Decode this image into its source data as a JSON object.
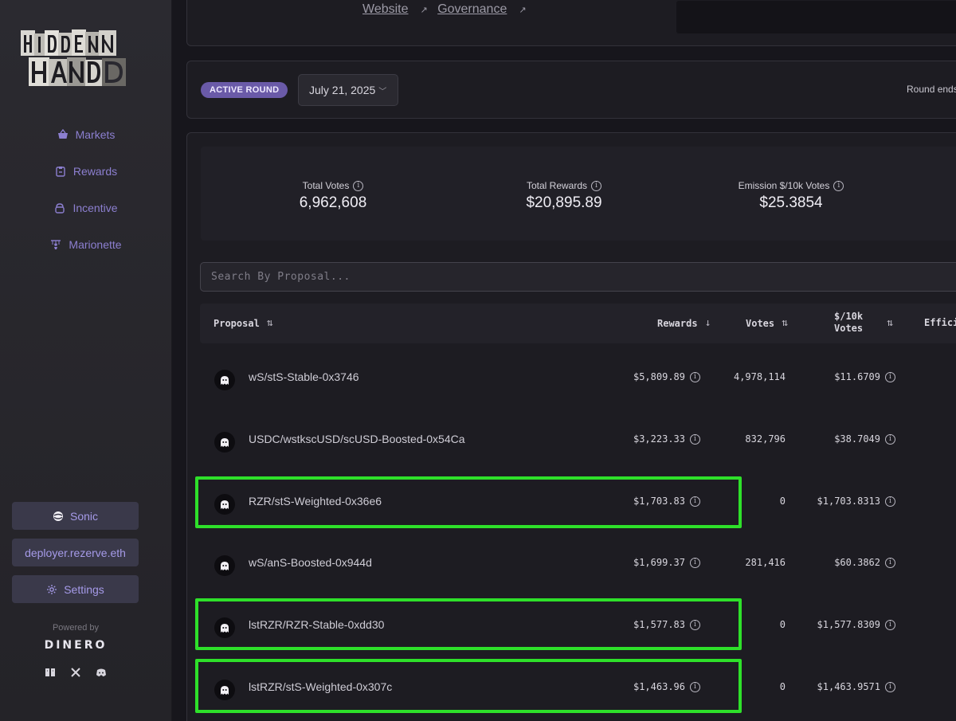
{
  "sidebar": {
    "nav": [
      {
        "label": "Markets",
        "icon": "basket-icon"
      },
      {
        "label": "Rewards",
        "icon": "clipboard-icon"
      },
      {
        "label": "Incentive",
        "icon": "bag-icon"
      },
      {
        "label": "Marionette",
        "icon": "puppet-icon"
      }
    ],
    "network_label": "Sonic",
    "account_label": "deployer.rezerve.eth",
    "settings_label": "Settings",
    "powered_by": "Powered by",
    "brand": "DINERO"
  },
  "top_links": {
    "website": "Website",
    "governance": "Governance"
  },
  "round": {
    "badge": "ACTIVE ROUND",
    "date": "July 21, 2025",
    "round_ends": "Round ends"
  },
  "stats": {
    "total_votes_label": "Total Votes",
    "total_votes": "6,962,608",
    "total_rewards_label": "Total Rewards",
    "total_rewards": "$20,895.89",
    "emission_label": "Emission $/10k Votes",
    "emission": "$25.3854"
  },
  "search": {
    "placeholder": "Search By Proposal..."
  },
  "table": {
    "headers": {
      "proposal": "Proposal",
      "rewards": "Rewards",
      "votes": "Votes",
      "per10k_line1": "$/10k",
      "per10k_line2": "Votes",
      "efficiency": "Effici"
    },
    "rows": [
      {
        "proposal": "wS/stS-Stable-0x3746",
        "rewards": "$5,809.89",
        "votes": "4,978,114",
        "per10k": "$11.6709",
        "icon_color": "#0d0c10"
      },
      {
        "proposal": "USDC/wstkscUSD/scUSD-Boosted-0x54Ca",
        "rewards": "$3,223.33",
        "votes": "832,796",
        "per10k": "$38.7049",
        "icon_color": "#0d0c10"
      },
      {
        "proposal": "RZR/stS-Weighted-0x36e6",
        "rewards": "$1,703.83",
        "votes": "0",
        "per10k": "$1,703.8313",
        "icon_color": "#0d0c10"
      },
      {
        "proposal": "wS/anS-Boosted-0x944d",
        "rewards": "$1,699.37",
        "votes": "281,416",
        "per10k": "$60.3862",
        "icon_color": "#0d0c10"
      },
      {
        "proposal": "lstRZR/RZR-Stable-0xdd30",
        "rewards": "$1,577.83",
        "votes": "0",
        "per10k": "$1,577.8309",
        "icon_color": "#0d0c10"
      },
      {
        "proposal": "lstRZR/stS-Weighted-0x307c",
        "rewards": "$1,463.96",
        "votes": "0",
        "per10k": "$1,463.9571",
        "icon_color": "#0d0c10"
      }
    ]
  },
  "colors": {
    "highlight": "#2ee02a",
    "accent": "#6a5aa8",
    "nav_text": "#8c7fd0"
  }
}
